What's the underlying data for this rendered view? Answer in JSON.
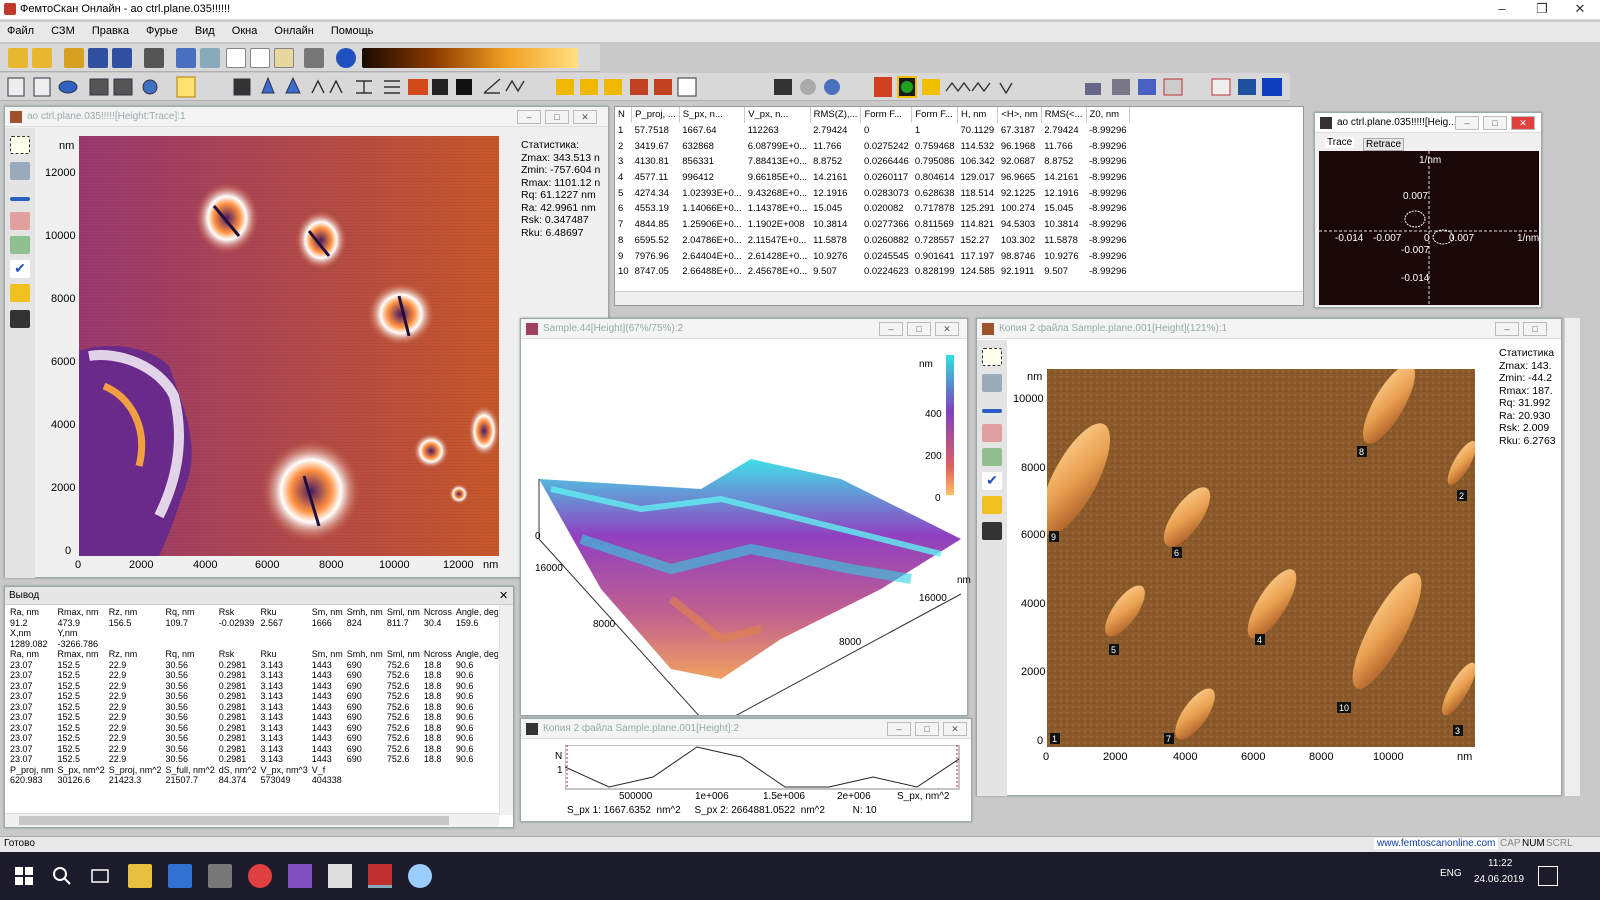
{
  "app": {
    "title": "ФемтоСкан Онлайн - ao ctrl.plane.035!!!!!!",
    "menu": [
      "Файл",
      "СЗМ",
      "Правка",
      "Фурье",
      "Вид",
      "Окна",
      "Онлайн",
      "Помощь"
    ]
  },
  "w1": {
    "title": "ao ctrl.plane.035!!!!![Height:Trace]:1",
    "y_unit": "nm",
    "x_unit": "nm",
    "yticks": [
      "12000",
      "10000",
      "8000",
      "6000",
      "4000",
      "2000",
      "0"
    ],
    "xticks": [
      "0",
      "2000",
      "4000",
      "6000",
      "8000",
      "10000",
      "12000"
    ],
    "stats": "Статистика:\nZmax: 343.513 n\nZmin: -757.604 n\nRmax: 1101.12 n\nRq: 61.1227 nm\nRa: 42.9961 nm\nRsk: 0.347487\nRku: 6.48697"
  },
  "table": {
    "headers": [
      "N",
      "P_proj, ...",
      "S_px, n...",
      "V_px, n...",
      "RMS(Z),...",
      "Form F...",
      "Form F...",
      "H, nm",
      "<H>, nm",
      "RMS(<...",
      "Z0, nm"
    ],
    "rows": [
      [
        "1",
        "57.7518",
        "1667.64",
        "112263",
        "2.79424",
        "0",
        "1",
        "70.1129",
        "67.3187",
        "2.79424",
        "-8.99296"
      ],
      [
        "2",
        "3419.67",
        "632868",
        "6.08799E+0...",
        "11.766",
        "0.0275242",
        "0.759468",
        "114.532",
        "96.1968",
        "11.766",
        "-8.99296"
      ],
      [
        "3",
        "4130.81",
        "856331",
        "7.88413E+0...",
        "8.8752",
        "0.0266446",
        "0.795086",
        "106.342",
        "92.0687",
        "8.8752",
        "-8.99296"
      ],
      [
        "4",
        "4577.11",
        "996412",
        "9.66185E+0...",
        "14.2161",
        "0.0260117",
        "0.804614",
        "129.017",
        "96.9665",
        "14.2161",
        "-8.99296"
      ],
      [
        "5",
        "4274.34",
        "1.02393E+0...",
        "9.43268E+0...",
        "12.1916",
        "0.0283073",
        "0.628638",
        "118.514",
        "92.1225",
        "12.1916",
        "-8.99296"
      ],
      [
        "6",
        "4553.19",
        "1.14066E+0...",
        "1.14378E+0...",
        "15.045",
        "0.020082",
        "0.717878",
        "125.291",
        "100.274",
        "15.045",
        "-8.99296"
      ],
      [
        "7",
        "4844.85",
        "1.25906E+0...",
        "1.1902E+008",
        "10.3814",
        "0.0277366",
        "0.811569",
        "114.821",
        "94.5303",
        "10.3814",
        "-8.99296"
      ],
      [
        "8",
        "6595.52",
        "2.04786E+0...",
        "2.11547E+0...",
        "11.5878",
        "0.0260882",
        "0.728557",
        "152.27",
        "103.302",
        "11.5878",
        "-8.99296"
      ],
      [
        "9",
        "7976.96",
        "2.64404E+0...",
        "2.61428E+0...",
        "10.9276",
        "0.0245545",
        "0.901641",
        "117.197",
        "98.8746",
        "10.9276",
        "-8.99296"
      ],
      [
        "10",
        "8747.05",
        "2.66488E+0...",
        "2.45678E+0...",
        "9.507",
        "0.0224623",
        "0.828199",
        "124.585",
        "92.1911",
        "9.507",
        "-8.99296"
      ]
    ]
  },
  "fft": {
    "title": "ao ctrl.plane.035!!!!![Heig...",
    "tab_trace": "Trace",
    "tab_retrace": "Retrace",
    "labels": {
      "top": "1/nm",
      "p007": "0.007",
      "m014x": "-0.014",
      "m007x": "-0.007",
      "zero": "0",
      "m007y": "-0.007",
      "p007x": "0.007",
      "right": "1/nm",
      "m014y": "-0.014"
    }
  },
  "w3d": {
    "title": "Sample.44[Height](67%/75%):2",
    "unit": "nm",
    "cb": [
      "400",
      "200",
      "0"
    ],
    "axis": [
      "16000",
      "8000",
      "16000",
      "8000",
      "0"
    ],
    "edge": "nm"
  },
  "w4": {
    "title": "Копия 2 файла Sample.plane.001[Height](121%):1",
    "y_unit": "nm",
    "x_unit": "nm",
    "yticks": [
      "10000",
      "8000",
      "6000",
      "4000",
      "2000",
      "0"
    ],
    "xticks": [
      "0",
      "2000",
      "4000",
      "6000",
      "8000",
      "10000"
    ],
    "stats": "Статистика\nZmax: 143.\nZmin: -44.2\nRmax: 187.\nRq: 31.992\nRa: 20.930\nRsk: 2.009\nRku: 6.2763",
    "markers": [
      "1",
      "2",
      "3",
      "4",
      "5",
      "6",
      "7",
      "8",
      "9",
      "10"
    ]
  },
  "out": {
    "title": "Вывод",
    "h1": [
      "Ra, nm",
      "Rmax, nm",
      "Rz, nm",
      "Rq, nm",
      "Rsk",
      "Rku",
      "Sm, nm",
      "Smh, nm",
      "Sml, nm",
      "Ncross",
      "Angle, deg"
    ],
    "r1": [
      "91.2",
      "473.9",
      "156.5",
      "109.7",
      "-0.02939",
      "2.567",
      "1666",
      "824",
      "811.7",
      "30.4",
      "159.6"
    ],
    "h2": [
      "X,nm",
      "Y,nm"
    ],
    "r2": [
      "1289.082",
      "-3266.786"
    ],
    "h3": [
      "Ra, nm",
      "Rmax, nm",
      "Rz, nm",
      "Rq, nm",
      "Rsk",
      "Rku",
      "Sm, nm",
      "Smh, nm",
      "Sml, nm",
      "Ncross",
      "Angle, deg"
    ],
    "r3": [
      "23.07",
      "152.5",
      "22.9",
      "30.56",
      "0.2981",
      "3.143",
      "1443",
      "690",
      "752.6",
      "18.8",
      "90.6"
    ],
    "h4": [
      "P_proj, nm",
      "S_px, nm^2",
      "S_proj, nm^2",
      "S_full, nm^2",
      "dS, nm^2",
      "V_px, nm^3",
      "V_f"
    ],
    "r4": [
      "620.983",
      "30126.6",
      "21423.3",
      "21507.7",
      "84.374",
      "573049",
      "404338"
    ]
  },
  "prof": {
    "title": "Копия 2 файла Sample.plane.001[Height]:2",
    "ylabel": "N",
    "y1": "1",
    "xt": [
      "500000",
      "1e+006",
      "1.5e+006",
      "2e+006"
    ],
    "xunit": "S_px, nm^2",
    "info": "S_px 1: 1667.6352  nm^2     S_px 2: 2664881.0522  nm^2          N: 10"
  },
  "status": {
    "text": "Готово",
    "url": "www.femtoscanonline.com",
    "cap": "CAP",
    "num": "NUM",
    "scrl": "SCRL"
  },
  "tray": {
    "lang": "ENG",
    "time": "11:22",
    "date": "24.06.2019"
  }
}
